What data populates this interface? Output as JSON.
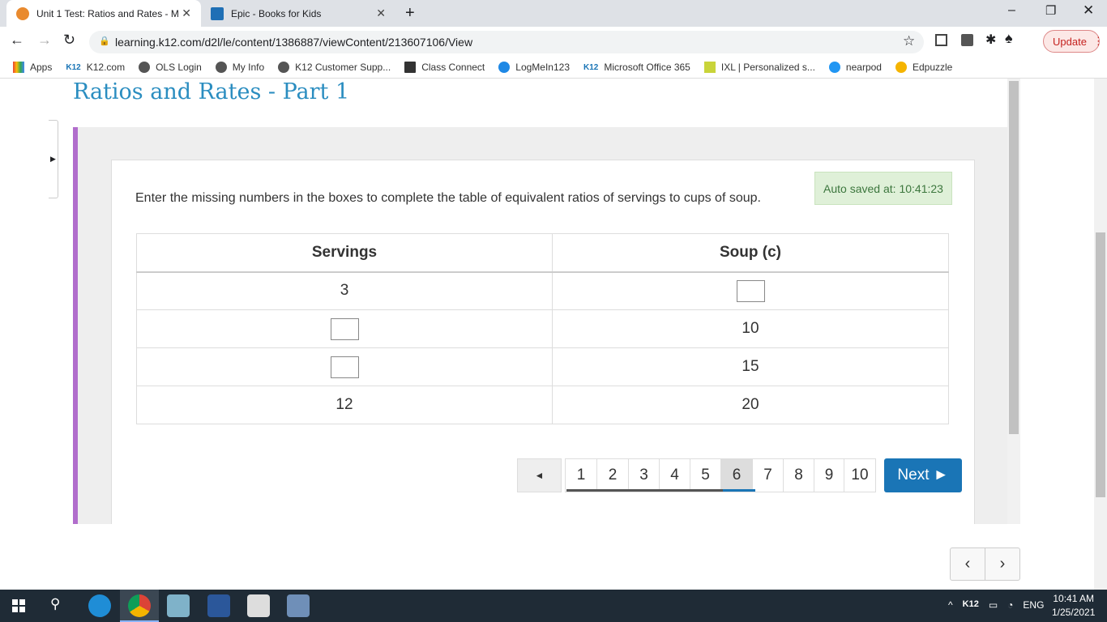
{
  "browser": {
    "tabs": [
      {
        "label": "Unit 1 Test: Ratios and Rates - M",
        "active": true
      },
      {
        "label": "Epic - Books for Kids",
        "active": false
      }
    ],
    "url": "learning.k12.com/d2l/le/content/1386887/viewContent/213607106/View",
    "update_label": "Update",
    "bookmarks": [
      "Apps",
      "K12.com",
      "OLS Login",
      "My Info",
      "K12 Customer Supp...",
      "Class Connect",
      "LogMeIn123",
      "Microsoft Office 365",
      "IXL | Personalized s...",
      "nearpod",
      "Edpuzzle"
    ]
  },
  "page": {
    "title": "Ratios and Rates - Part 1",
    "prompt": "Enter the missing numbers in the boxes to complete the table of equivalent ratios of servings to cups of soup.",
    "autosave": "Auto saved at: 10:41:23",
    "table": {
      "headers": [
        "Servings",
        "Soup (c)"
      ],
      "rows": [
        [
          "3",
          ""
        ],
        [
          "",
          "10"
        ],
        [
          "",
          "15"
        ],
        [
          "12",
          "20"
        ]
      ]
    },
    "pagination": {
      "pages": [
        "1",
        "2",
        "3",
        "4",
        "5",
        "6",
        "7",
        "8",
        "9",
        "10"
      ],
      "current": "6",
      "prev_label": "◄",
      "next_label": "Next ►"
    },
    "accent": "#1a75b6"
  },
  "taskbar": {
    "time": "10:41 AM",
    "date": "1/25/2021",
    "lang": "ENG",
    "k12": "K12"
  }
}
